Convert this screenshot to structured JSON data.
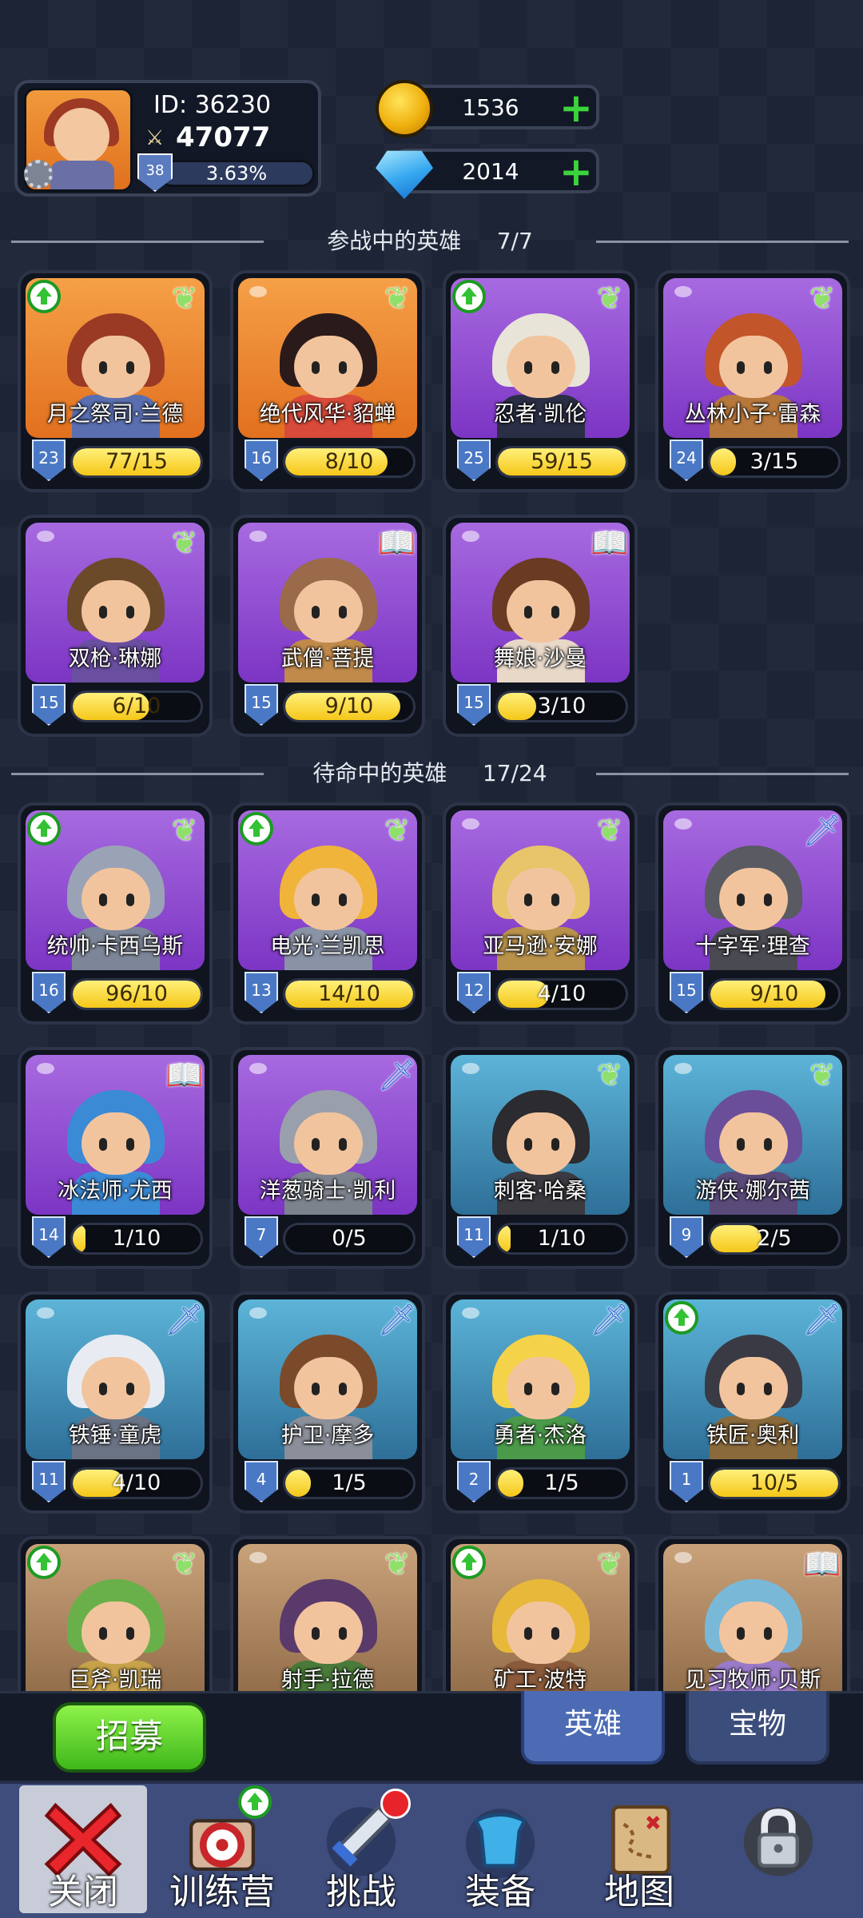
{
  "player": {
    "id_text": "ID: 36230",
    "power": "47077",
    "level": "38",
    "xp_percent_text": "3.63%",
    "xp_fraction": 0.0363
  },
  "resources": {
    "gold": "1536",
    "gems": "2014"
  },
  "sections": {
    "active": {
      "title": "参战中的英雄",
      "count": "7/7"
    },
    "standby": {
      "title": "待命中的英雄",
      "count": "17/24"
    }
  },
  "active_heroes": [
    {
      "name": "月之祭司·兰德",
      "level": "23",
      "progress": "77/15",
      "fill": 1.0,
      "bg": "orange",
      "class_icon": "wing-icon",
      "upgrade": true,
      "hair": "#9a3a24",
      "body": "#5a6fb0"
    },
    {
      "name": "绝代风华·貂蝉",
      "level": "16",
      "progress": "8/10",
      "fill": 0.8,
      "bg": "orange",
      "class_icon": "wing-icon",
      "upgrade": false,
      "hair": "#2b1a1a",
      "body": "#d84a3a"
    },
    {
      "name": "忍者·凯伦",
      "level": "25",
      "progress": "59/15",
      "fill": 1.0,
      "bg": "purple",
      "class_icon": "wing-icon",
      "upgrade": true,
      "hair": "#e9e4d8",
      "body": "#2b2f45"
    },
    {
      "name": "丛林小子·雷森",
      "level": "24",
      "progress": "3/15",
      "fill": 0.2,
      "bg": "purple",
      "class_icon": "wing-icon",
      "upgrade": false,
      "hair": "#c2552a",
      "body": "#b8783c"
    },
    {
      "name": "双枪·琳娜",
      "level": "15",
      "progress": "6/10",
      "fill": 0.6,
      "bg": "purple",
      "class_icon": "wing-icon",
      "upgrade": false,
      "hair": "#6b4a2a",
      "body": "#6a4ea0"
    },
    {
      "name": "武僧·菩提",
      "level": "15",
      "progress": "9/10",
      "fill": 0.9,
      "bg": "purple",
      "class_icon": "book-icon",
      "upgrade": false,
      "hair": "#9a6a4a",
      "body": "#c08a4a"
    },
    {
      "name": "舞娘·沙曼",
      "level": "15",
      "progress": "3/10",
      "fill": 0.3,
      "bg": "purple",
      "class_icon": "book-icon",
      "upgrade": false,
      "hair": "#6a3a22",
      "body": "#e8d8c8"
    }
  ],
  "standby_heroes": [
    {
      "name": "统帅·卡西乌斯",
      "level": "16",
      "progress": "96/10",
      "fill": 1.0,
      "bg": "purple",
      "class_icon": "wing-icon",
      "upgrade": true,
      "hair": "#9aa3b5",
      "body": "#7d8698"
    },
    {
      "name": "电光·兰凯思",
      "level": "13",
      "progress": "14/10",
      "fill": 1.0,
      "bg": "purple",
      "class_icon": "wing-icon",
      "upgrade": true,
      "hair": "#f0b43a",
      "body": "#8a93a6"
    },
    {
      "name": "亚马逊·安娜",
      "level": "12",
      "progress": "4/10",
      "fill": 0.4,
      "bg": "purple",
      "class_icon": "wing-icon",
      "upgrade": false,
      "hair": "#e8c46a",
      "body": "#b8914a"
    },
    {
      "name": "十字军·理查",
      "level": "15",
      "progress": "9/10",
      "fill": 0.9,
      "bg": "purple",
      "class_icon": "dagger-icon",
      "upgrade": false,
      "hair": "#5a5a62",
      "body": "#4a4a52"
    },
    {
      "name": "冰法师·尤西",
      "level": "14",
      "progress": "1/10",
      "fill": 0.1,
      "bg": "purple",
      "class_icon": "book-icon",
      "upgrade": false,
      "hair": "#3b8ad6",
      "body": "#3b8ad6"
    },
    {
      "name": "洋葱骑士·凯利",
      "level": "7",
      "progress": "0/5",
      "fill": 0.0,
      "bg": "purple",
      "class_icon": "dagger-icon",
      "upgrade": false,
      "hair": "#9aa0ab",
      "body": "#7d838e"
    },
    {
      "name": "刺客·哈桑",
      "level": "11",
      "progress": "1/10",
      "fill": 0.1,
      "bg": "blue",
      "class_icon": "wing-icon",
      "upgrade": false,
      "hair": "#2b2b30",
      "body": "#3a3a40"
    },
    {
      "name": "游侠·娜尔茜",
      "level": "9",
      "progress": "2/5",
      "fill": 0.4,
      "bg": "blue",
      "class_icon": "wing-icon",
      "upgrade": false,
      "hair": "#6a4e9a",
      "body": "#5a4a7a"
    },
    {
      "name": "铁锤·童虎",
      "level": "11",
      "progress": "4/10",
      "fill": 0.4,
      "bg": "blue",
      "class_icon": "dagger-icon",
      "upgrade": false,
      "hair": "#e8ecf2",
      "body": "#6a7384"
    },
    {
      "name": "护卫·摩多",
      "level": "4",
      "progress": "1/5",
      "fill": 0.2,
      "bg": "blue",
      "class_icon": "dagger-icon",
      "upgrade": false,
      "hair": "#7a4a2a",
      "body": "#8a8f9a"
    },
    {
      "name": "勇者·杰洛",
      "level": "2",
      "progress": "1/5",
      "fill": 0.2,
      "bg": "blue",
      "class_icon": "dagger-icon",
      "upgrade": false,
      "hair": "#f4d24a",
      "body": "#4a9a4a"
    },
    {
      "name": "铁匠·奥利",
      "level": "1",
      "progress": "10/5",
      "fill": 1.0,
      "bg": "blue",
      "class_icon": "dagger-icon",
      "upgrade": true,
      "hair": "#3a3a44",
      "body": "#8a6a3a"
    },
    {
      "name": "巨斧·凯瑞",
      "level": "",
      "progress": "",
      "fill": 0,
      "bg": "brown",
      "class_icon": "wing-icon",
      "upgrade": true,
      "hair": "#6ab04a",
      "body": "#c8a24a"
    },
    {
      "name": "射手·拉德",
      "level": "",
      "progress": "",
      "fill": 0,
      "bg": "brown",
      "class_icon": "wing-icon",
      "upgrade": false,
      "hair": "#5a3a6a",
      "body": "#4a7a3a"
    },
    {
      "name": "矿工·波特",
      "level": "",
      "progress": "",
      "fill": 0,
      "bg": "brown",
      "class_icon": "wing-icon",
      "upgrade": true,
      "hair": "#e8b83a",
      "body": "#8a5a3a"
    },
    {
      "name": "见习牧师·贝斯",
      "level": "",
      "progress": "",
      "fill": 0,
      "bg": "brown",
      "class_icon": "book-icon",
      "upgrade": false,
      "hair": "#7ab8d8",
      "body": "#9a7ac8"
    }
  ],
  "actions": {
    "recruit": "招募",
    "tab_heroes": "英雄",
    "tab_treasure": "宝物"
  },
  "nav": [
    {
      "label": "关闭",
      "icon": "close-icon"
    },
    {
      "label": "训练营",
      "icon": "target-icon"
    },
    {
      "label": "挑战",
      "icon": "sword-icon"
    },
    {
      "label": "装备",
      "icon": "armor-icon"
    },
    {
      "label": "地图",
      "icon": "map-icon"
    },
    {
      "label": "",
      "icon": "lock-icon"
    }
  ]
}
